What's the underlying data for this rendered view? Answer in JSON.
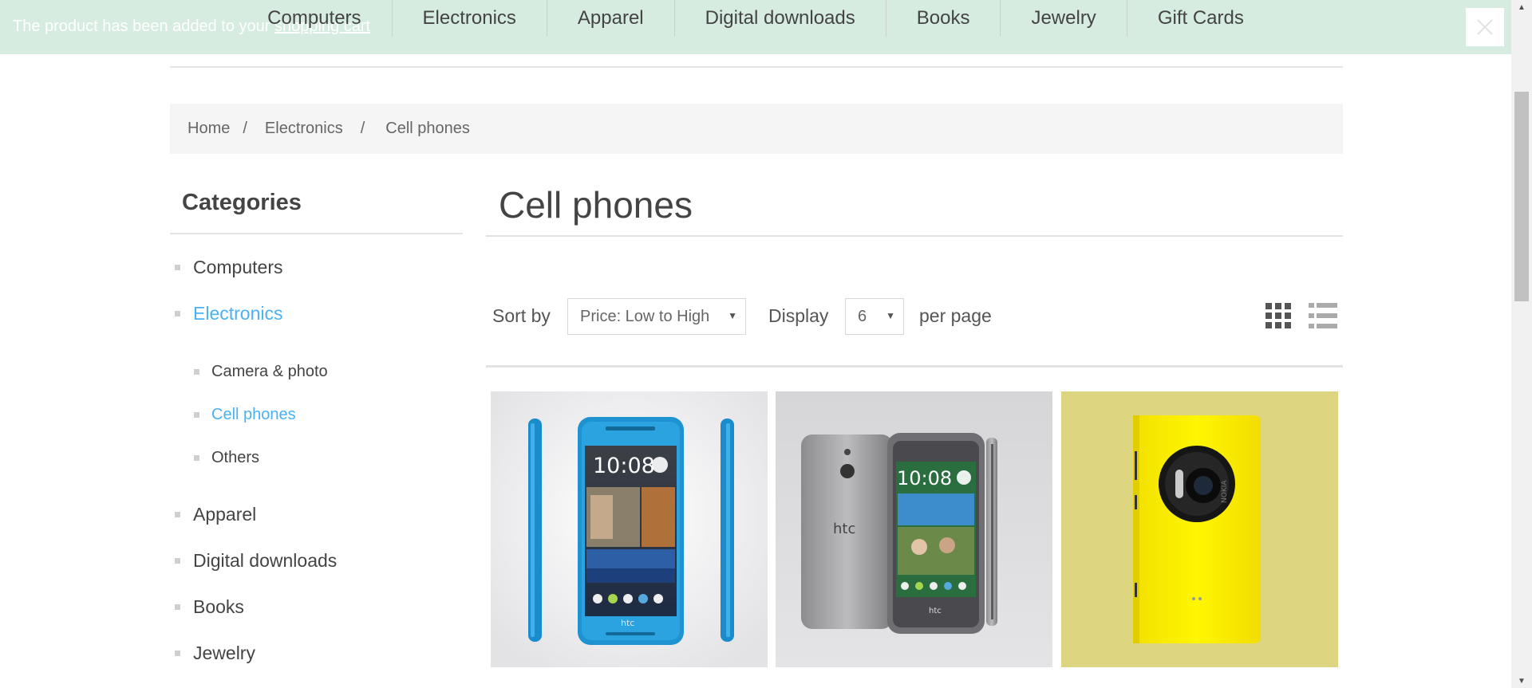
{
  "notification": {
    "text": "The product has been added to your ",
    "link_label": "shopping cart"
  },
  "top_menu": {
    "items": [
      "Computers",
      "Electronics",
      "Apparel",
      "Digital downloads",
      "Books",
      "Jewelry",
      "Gift Cards"
    ]
  },
  "breadcrumb": {
    "items": [
      "Home",
      "Electronics",
      "Cell phones"
    ],
    "separator": "/"
  },
  "sidebar": {
    "title": "Categories",
    "items": [
      {
        "label": "Computers",
        "active": false
      },
      {
        "label": "Electronics",
        "active": true
      },
      {
        "label": "Apparel",
        "active": false
      },
      {
        "label": "Digital downloads",
        "active": false
      },
      {
        "label": "Books",
        "active": false
      },
      {
        "label": "Jewelry",
        "active": false
      }
    ],
    "subitems": [
      {
        "label": "Camera & photo",
        "active": false
      },
      {
        "label": "Cell phones",
        "active": true
      },
      {
        "label": "Others",
        "active": false
      }
    ]
  },
  "main": {
    "title": "Cell phones",
    "sort_label": "Sort by",
    "sort_value": "Price: Low to High",
    "display_label": "Display",
    "display_value": "6",
    "per_page_label": "per page"
  },
  "products": {
    "phone1": {
      "screen_time": "10:08",
      "brand": "htc"
    },
    "phone2": {
      "screen_time": "10:08",
      "brand": "htc"
    },
    "phone3": {
      "brand": "NOKIA"
    }
  },
  "colors": {
    "accent": "#4ab2f1",
    "notification_bg": "#d6ece0",
    "breadcrumb_bg": "#f5f5f5",
    "phone3_bg": "#ddd57f",
    "phone3_body": "#ffed00"
  }
}
